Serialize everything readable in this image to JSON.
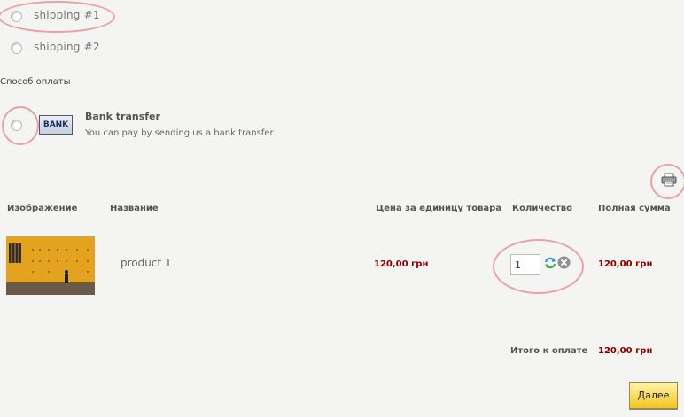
{
  "shipping": {
    "options": [
      {
        "label": "shipping #1"
      },
      {
        "label": "shipping #2"
      }
    ]
  },
  "payment": {
    "section_label": "Способ оплаты",
    "method": {
      "logo_text": "BANK",
      "title": "Bank transfer",
      "description": "You can pay by sending us a bank transfer."
    }
  },
  "cart": {
    "print_icon": "printer-icon",
    "headers": {
      "image": "Изображение",
      "name": "Название",
      "unit_price": "Цена за единицу товара",
      "quantity": "Количество",
      "total": "Полная сумма"
    },
    "rows": [
      {
        "name": "product 1",
        "unit_price": "120,00 грн",
        "quantity": "1",
        "total": "120,00 грн"
      }
    ],
    "grand_total_label": "Итого к оплате",
    "grand_total": "120,00 грн"
  },
  "next_button": "Далее",
  "colors": {
    "price": "#8b0000",
    "highlight_ring": "#e8a2a7",
    "button": "#f3c41a"
  }
}
